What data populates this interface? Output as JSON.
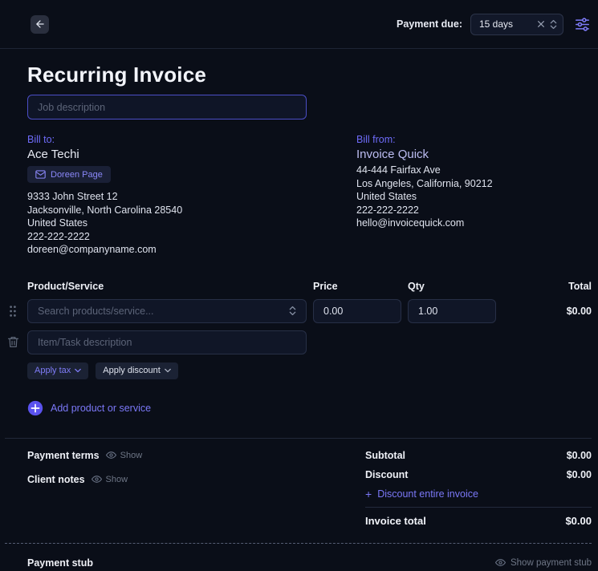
{
  "colors": {
    "background": "#0a0e18",
    "accent": "#7b78f7",
    "input_border": "#272f46",
    "focused_border": "#4b4ec6"
  },
  "icons": {
    "back": "arrow-left",
    "clear": "x",
    "stepper": "chevrons-up-down",
    "settings": "sliders",
    "contact": "envelope",
    "drag": "drag-dots",
    "delete": "trash",
    "visibility": "eye",
    "add": "plus-circle"
  },
  "topbar": {
    "payment_due_label": "Payment due:",
    "payment_due_value": "15 days"
  },
  "header": {
    "title": "Recurring Invoice",
    "job_description_placeholder": "Job description"
  },
  "bill_to": {
    "label": "Bill to:",
    "name": "Ace Techi",
    "contact_chip": "Doreen Page",
    "address_lines": [
      "9333 John Street 12",
      "Jacksonville, North Carolina 28540",
      "United States",
      "222-222-2222",
      "doreen@companyname.com"
    ]
  },
  "bill_from": {
    "label": "Bill from:",
    "name": "Invoice Quick",
    "address_lines": [
      "44-444 Fairfax Ave",
      "Los Angeles, California, 90212",
      "United States",
      "222-222-2222",
      "hello@invoicequick.com"
    ]
  },
  "items_table": {
    "headers": {
      "product": "Product/Service",
      "price": "Price",
      "qty": "Qty",
      "total": "Total"
    },
    "row": {
      "product_placeholder": "Search products/service...",
      "price_value": "0.00",
      "qty_value": "1.00",
      "total": "$0.00",
      "description_placeholder": "Item/Task description",
      "apply_tax_label": "Apply tax",
      "apply_discount_label": "Apply discount"
    },
    "add_button_label": "Add product or service"
  },
  "summary": {
    "payment_terms_label": "Payment terms",
    "payment_terms_toggle": "Show",
    "client_notes_label": "Client notes",
    "client_notes_toggle": "Show",
    "subtotal_label": "Subtotal",
    "subtotal_value": "$0.00",
    "discount_label": "Discount",
    "discount_value": "$0.00",
    "discount_entire_label": "Discount entire invoice",
    "invoice_total_label": "Invoice total",
    "invoice_total_value": "$0.00"
  },
  "payment_stub": {
    "label": "Payment stub",
    "toggle_label": "Show payment stub"
  }
}
